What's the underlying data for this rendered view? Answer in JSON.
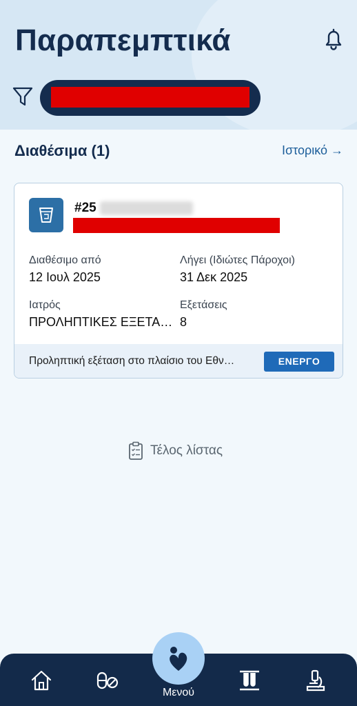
{
  "header": {
    "title": "Παραπεμπτικά"
  },
  "section": {
    "title": "Διαθέσιμα (1)",
    "history_link": "Ιστορικό →"
  },
  "card": {
    "number_prefix": "#25",
    "available_from_label": "Διαθέσιμο από",
    "available_from_value": "12 Ιουλ 2025",
    "expires_label": "Λήγει (Ιδιώτες Πάροχοι)",
    "expires_value": "31 Δεκ 2025",
    "doctor_label": "Ιατρός",
    "doctor_value": "ΠΡΟΛΗΠΤΙΚΕΣ ΕΞΕΤΑ…",
    "exams_label": "Εξετάσεις",
    "exams_value": "8",
    "footer_text": "Προληπτική εξέταση στο πλαίσιο του Εθν…",
    "status": "ΕΝΕΡΓΟ"
  },
  "end_of_list": "Τέλος λίστας",
  "bottom_nav": {
    "menu_label": "Μενού",
    "items": [
      "home-icon",
      "medication-icon",
      "menu-icon",
      "lab-tests-icon",
      "microscope-icon"
    ]
  },
  "colors": {
    "primary_dark": "#142c4e",
    "accent_blue": "#1f6ab8",
    "header_bg": "#d6e7f4",
    "redaction": "#e00000"
  }
}
